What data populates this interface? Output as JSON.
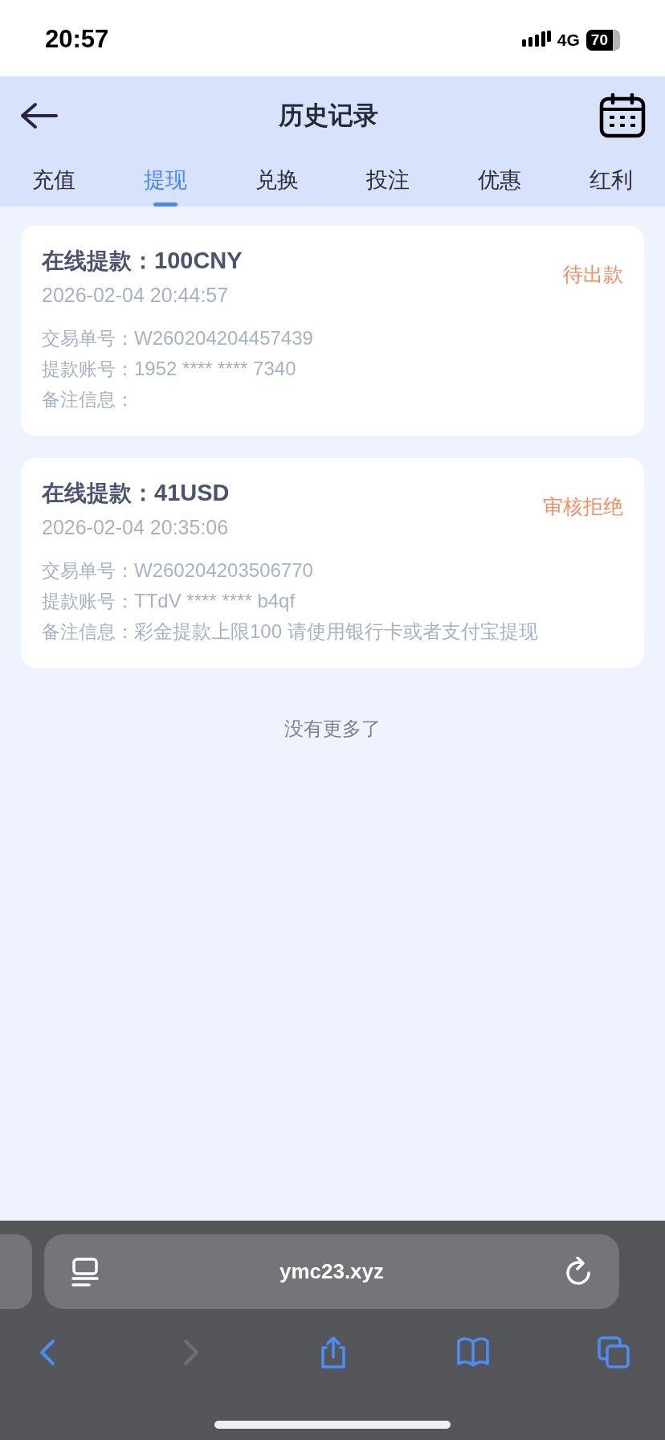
{
  "status_bar": {
    "time": "20:57",
    "network": "4G",
    "battery": "70"
  },
  "header": {
    "title": "历史记录"
  },
  "tabs": [
    {
      "label": "充值",
      "selected": false
    },
    {
      "label": "提现",
      "selected": true
    },
    {
      "label": "兑换",
      "selected": false
    },
    {
      "label": "投注",
      "selected": false
    },
    {
      "label": "优惠",
      "selected": false
    },
    {
      "label": "红利",
      "selected": false
    }
  ],
  "records": [
    {
      "title": "在线提款：",
      "amount": "100CNY",
      "time": "2026-02-04 20:44:57",
      "status": "待出款",
      "fields": [
        {
          "label": "交易单号：",
          "value": "W260204204457439"
        },
        {
          "label": "提款账号：",
          "value": "1952 **** **** 7340"
        },
        {
          "label": "备注信息："
        }
      ]
    },
    {
      "title": "在线提款：",
      "amount": "41USD",
      "time": "2026-02-04 20:35:06",
      "status": "审核拒绝",
      "fields": [
        {
          "label": "交易单号：",
          "value": "W260204203506770"
        },
        {
          "label": "提款账号：",
          "value": "TTdV **** **** b4qf"
        },
        {
          "label": "备注信息：",
          "value": "彩金提款上限100 请使用银行卡或者支付宝提现"
        }
      ]
    }
  ],
  "end_text": "没有更多了",
  "browser": {
    "url": "ymc23.xyz",
    "toolbar": [
      {
        "kind": "back",
        "disabled": false
      },
      {
        "kind": "forward",
        "disabled": true
      },
      {
        "kind": "share",
        "disabled": false
      },
      {
        "kind": "bookmarks",
        "disabled": false
      },
      {
        "kind": "tabs",
        "disabled": false
      }
    ]
  }
}
